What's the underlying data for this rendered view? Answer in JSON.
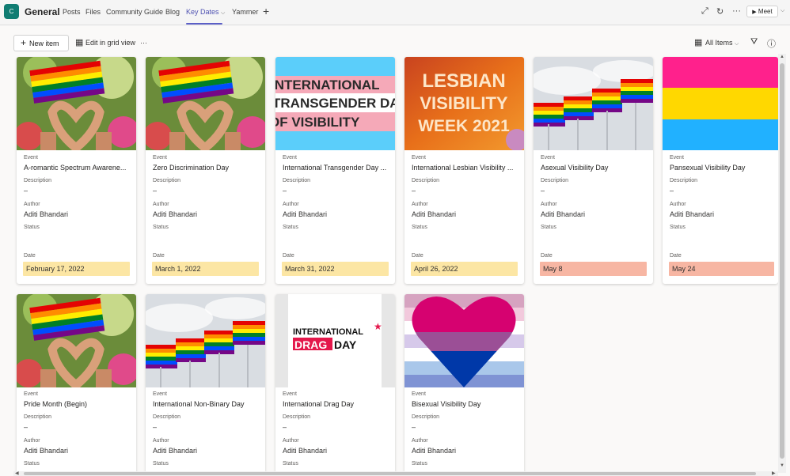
{
  "header": {
    "team_initial": "C",
    "channel": "General",
    "tabs": [
      {
        "label": "Posts"
      },
      {
        "label": "Files"
      },
      {
        "label": "Community Guide"
      },
      {
        "label": "Blog"
      },
      {
        "label": "Key Dates",
        "active": true
      },
      {
        "label": "Yammer"
      }
    ],
    "add_tab": "+",
    "meet_label": "Meet",
    "icons": [
      "expand-icon",
      "refresh-icon",
      "more-icon",
      "video-icon",
      "chevron-down-icon"
    ]
  },
  "commandbar": {
    "new_item": "New item",
    "edit_grid": "Edit in grid view",
    "more": "···",
    "view_label": "All Items"
  },
  "fields": {
    "event": "Event",
    "description": "Description",
    "author": "Author",
    "status": "Status",
    "date": "Date",
    "empty": "–"
  },
  "cards": [
    {
      "event": "A-romantic Spectrum Awarene...",
      "author": "Aditi Bhandari",
      "date": "February 17, 2022",
      "date_color": "#fce6a4",
      "image": "pride-hands"
    },
    {
      "event": "Zero Discrimination Day",
      "author": "Aditi Bhandari",
      "date": "March 1, 2022",
      "date_color": "#fce6a4",
      "image": "pride-hands"
    },
    {
      "event": "International Transgender Day ...",
      "author": "Aditi Bhandari",
      "date": "March 31, 2022",
      "date_color": "#fce6a4",
      "image": "trans-banner"
    },
    {
      "event": "International Lesbian Visibility ...",
      "author": "Aditi Bhandari",
      "date": "April 26, 2022",
      "date_color": "#fce6a4",
      "image": "lesbian-week"
    },
    {
      "event": "Asexual Visibility Day",
      "author": "Aditi Bhandari",
      "date": "May 8",
      "date_color": "#f7b6a3",
      "image": "flags-row"
    },
    {
      "event": "Pansexual Visibility Day",
      "author": "Aditi Bhandari",
      "date": "May 24",
      "date_color": "#f7b6a3",
      "image": "pan-flag"
    },
    {
      "event": "Pride Month (Begin)",
      "author": "Aditi Bhandari",
      "date": "",
      "image": "pride-hands"
    },
    {
      "event": "International Non-Binary Day",
      "author": "Aditi Bhandari",
      "date": "",
      "image": "flags-row"
    },
    {
      "event": "International Drag Day",
      "author": "Aditi Bhandari",
      "date": "",
      "image": "drag-day"
    },
    {
      "event": "Bisexual Visibility Day",
      "author": "Aditi Bhandari",
      "date": "",
      "image": "bi-heart"
    }
  ],
  "image_text": {
    "trans": [
      "INTERNATIONAL",
      "TRANSGENDER DAY",
      "OF VISIBILITY"
    ],
    "lesbian": [
      "LESBIAN",
      "VISIBILITY",
      "WEEK 2021"
    ],
    "drag_top": "INTERNATIONAL",
    "drag_word": "DRAG",
    "drag_day": "DAY"
  },
  "colors": {
    "accent": "#5b5fc7",
    "team": "#107c72",
    "upcoming_date": "#fce6a4",
    "near_date": "#f7b6a3"
  }
}
